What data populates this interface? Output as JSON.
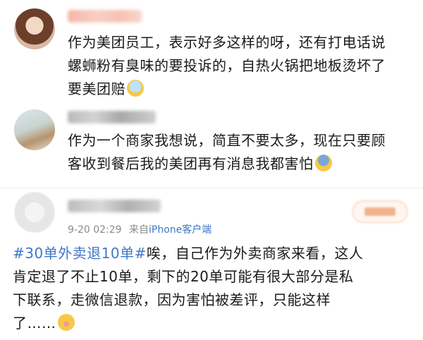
{
  "comments": [
    {
      "username": "",
      "text_lines": [
        "作为美团员工，表示好多这样的呀，还有打电话说",
        "螺蛳粉有臭味的要投诉的，自热火锅把地板烫坏了",
        "要美团赔"
      ],
      "emoji": "scared-face-emoji"
    },
    {
      "username": "",
      "text_lines": [
        "作为一个商家我想说，简直不要太多，现在只要顾",
        "客收到餐后我的美团再有消息我都害怕"
      ],
      "emoji": "fearful-face-emoji"
    }
  ],
  "post": {
    "username": "",
    "timestamp": "9-20 02:29",
    "source_prefix": "来自",
    "source": "iPhone客户端",
    "hashtag": "#30单外卖退10单#",
    "line1_rest": "唉，自己作为外卖商家来看，这人",
    "line2": "肯定退了不止10单，剩下的20单可能有很大部分是私",
    "line3": "下联系，走微信退款，因为害怕被差评，只能这样",
    "line4": "了……",
    "emoji": "flushed-face-emoji"
  }
}
